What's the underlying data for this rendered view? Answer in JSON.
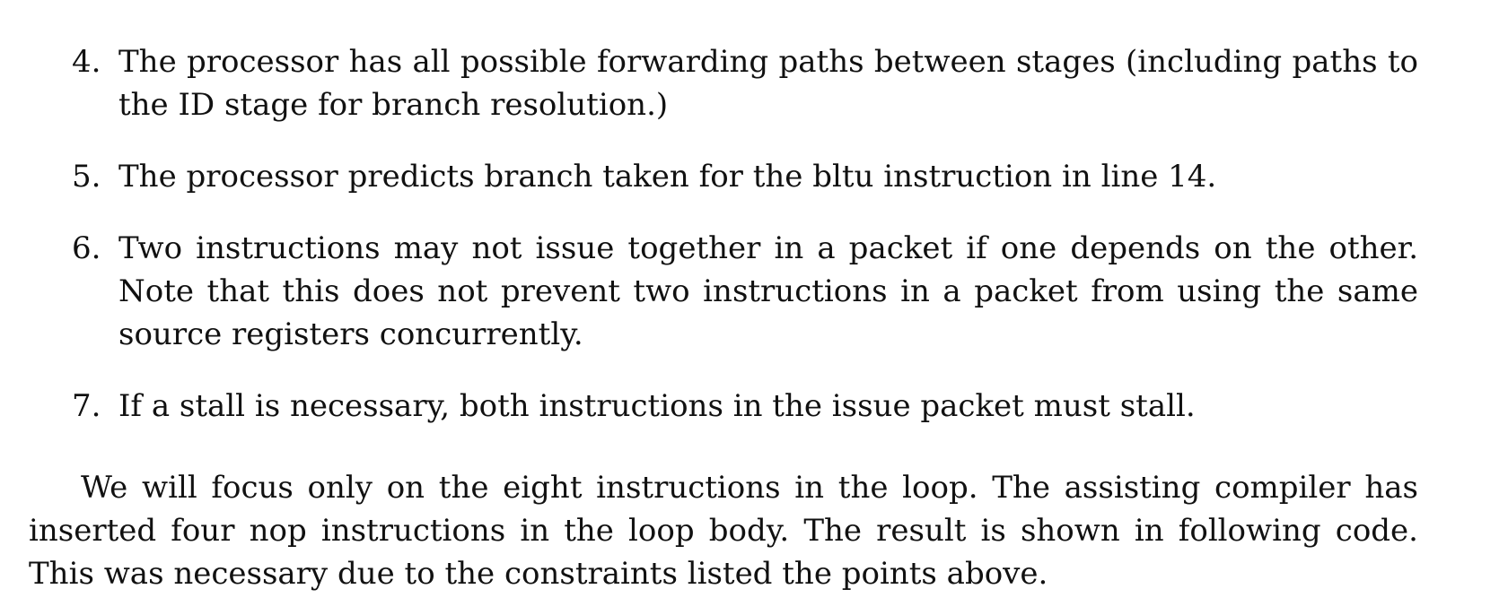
{
  "items": [
    {
      "number": "4.",
      "text": "The processor has all possible forwarding paths between stages (including paths to the ID stage for branch resolution.)"
    },
    {
      "number": "5.",
      "text": "The processor predicts branch taken for the bltu instruction in line 14."
    },
    {
      "number": "6.",
      "text": "Two instructions may not issue together in a packet if one depends on the other. Note that this does not prevent two instructions in a packet from using the same source registers concurrently."
    },
    {
      "number": "7.",
      "text": "If a stall is necessary, both instructions in the issue packet must stall."
    }
  ],
  "paragraph": "We will focus only on the eight instructions in the loop. The assisting compiler has inserted four nop instructions in the loop body. The result is shown in following code. This was necessary due to the constraints listed the points above."
}
